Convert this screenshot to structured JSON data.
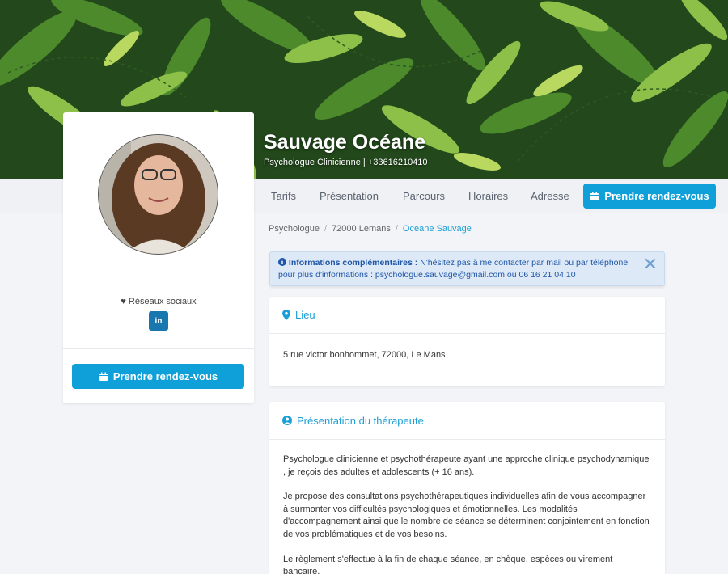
{
  "profile": {
    "name": "Sauvage Océane",
    "subtitle": "Psychologue Clinicienne | +33616210410"
  },
  "nav": {
    "items": [
      "Tarifs",
      "Présentation",
      "Parcours",
      "Horaires",
      "Adresse"
    ],
    "cta_label": "Prendre rendez-vous"
  },
  "sidebar": {
    "social_label": "Réseaux sociaux",
    "linkedin_label": "in",
    "cta_label": "Prendre rendez-vous"
  },
  "breadcrumb": [
    "Psychologue",
    "72000 Lemans",
    "Oceane Sauvage"
  ],
  "alert": {
    "title": "Informations complémentaires :",
    "text": "N'hésitez pas à me contacter par mail ou par téléphone pour plus d'informations : psychologue.sauvage@gmail.com ou 06 16 21 04 10"
  },
  "lieu": {
    "title": "Lieu",
    "address": "5 rue victor bonhommet, 72000, Le Mans"
  },
  "presentation": {
    "title": "Présentation du thérapeute",
    "paragraphs": [
      "Psychologue clinicienne et psychothérapeute ayant une approche clinique psychodynamique , je reçois des adultes et adolescents (+ 16 ans).",
      "Je propose des consultations psychothérapeutiques individuelles afin de vous accompagner à surmonter vos difficultés psychologiques et émotionnelles. Les modalités d'accompagnement ainsi que le nombre de séance se déterminent conjointement en fonction de vos problématiques et de vos besoins.",
      "Le règlement s'effectue à la fin de chaque séance, en chèque, espèces ou virement bancaire."
    ]
  },
  "colors": {
    "accent": "#0fa0d9",
    "banner": "#1f4a1a",
    "alert_bg": "#dde9f6",
    "alert_text": "#1f56a8",
    "linkedin": "#1977b0"
  },
  "icons": [
    "heart-icon",
    "linkedin-icon",
    "calendar-icon",
    "info-icon",
    "close-icon",
    "map-marker-icon",
    "user-circle-icon"
  ]
}
